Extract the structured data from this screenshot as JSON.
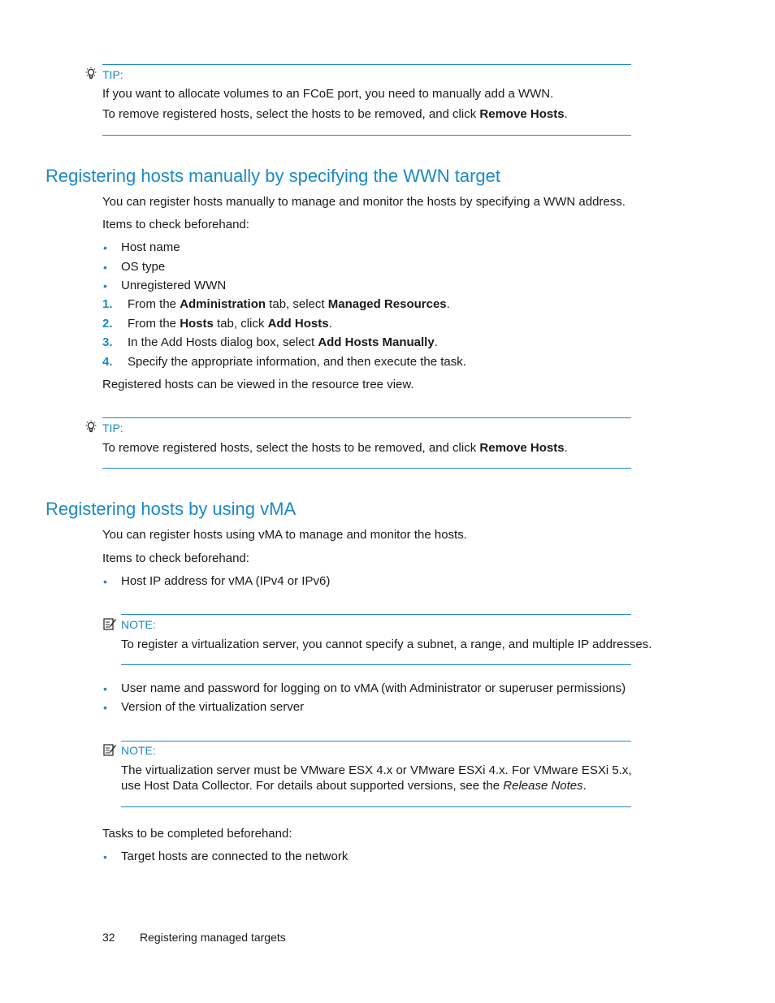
{
  "tip1": {
    "label": "TIP:",
    "icon": "lightbulb-icon",
    "lines": [
      {
        "text": "If you want to allocate volumes to an FCoE port, you need to manually add a WWN."
      },
      {
        "pre": "To remove registered hosts, select the hosts to be removed, and click ",
        "bold": "Remove Hosts",
        "post": "."
      }
    ]
  },
  "section1": {
    "title": "Registering hosts manually by specifying the WWN target",
    "intro": "You can register hosts manually to manage and monitor the hosts by specifying a WWN address.",
    "check_label": "Items to check beforehand:",
    "check_items": [
      "Host name",
      "OS type",
      "Unregistered WWN"
    ],
    "steps": [
      {
        "num": "1.",
        "parts": [
          {
            "t": "From the "
          },
          {
            "b": "Administration"
          },
          {
            "t": " tab, select "
          },
          {
            "b": "Managed Resources"
          },
          {
            "t": "."
          }
        ]
      },
      {
        "num": "2.",
        "parts": [
          {
            "t": "From the "
          },
          {
            "b": "Hosts"
          },
          {
            "t": " tab, click "
          },
          {
            "b": "Add Hosts"
          },
          {
            "t": "."
          }
        ]
      },
      {
        "num": "3.",
        "parts": [
          {
            "t": "In the Add Hosts dialog box, select "
          },
          {
            "b": "Add Hosts Manually"
          },
          {
            "t": "."
          }
        ]
      },
      {
        "num": "4.",
        "parts": [
          {
            "t": "Specify the appropriate information, and then execute the task."
          }
        ]
      }
    ],
    "after": "Registered hosts can be viewed in the resource tree view."
  },
  "tip2": {
    "label": "TIP:",
    "icon": "lightbulb-icon",
    "pre": "To remove registered hosts, select the hosts to be removed, and click ",
    "bold": "Remove Hosts",
    "post": "."
  },
  "section2": {
    "title": "Registering hosts by using vMA",
    "intro": "You can register hosts using vMA to manage and monitor the hosts.",
    "check_label": "Items to check beforehand:",
    "check_items_a": [
      "Host IP address for vMA (IPv4 or IPv6)"
    ],
    "note1": {
      "label": "NOTE:",
      "icon": "note-pencil-icon",
      "text": "To register a virtualization server, you cannot specify a subnet, a range, and multiple IP addresses."
    },
    "check_items_b": [
      "User name and password for logging on to vMA (with Administrator or superuser permissions)",
      "Version of the virtualization server"
    ],
    "note2": {
      "label": "NOTE:",
      "icon": "note-pencil-icon",
      "line1": "The virtualization server must be VMware ESX 4.x or VMware ESXi 4.x. For VMware ESXi 5.x,",
      "line2_pre": "use Host Data Collector. For details about supported versions, see the ",
      "line2_italic": "Release Notes",
      "line2_post": "."
    },
    "tasks_label": "Tasks to be completed beforehand:",
    "task_items": [
      "Target hosts are connected to the network"
    ]
  },
  "footer": {
    "page_number": "32",
    "chapter": "Registering managed targets"
  },
  "colors": {
    "accent": "#1a8ac6",
    "text": "#1a1a1a"
  }
}
